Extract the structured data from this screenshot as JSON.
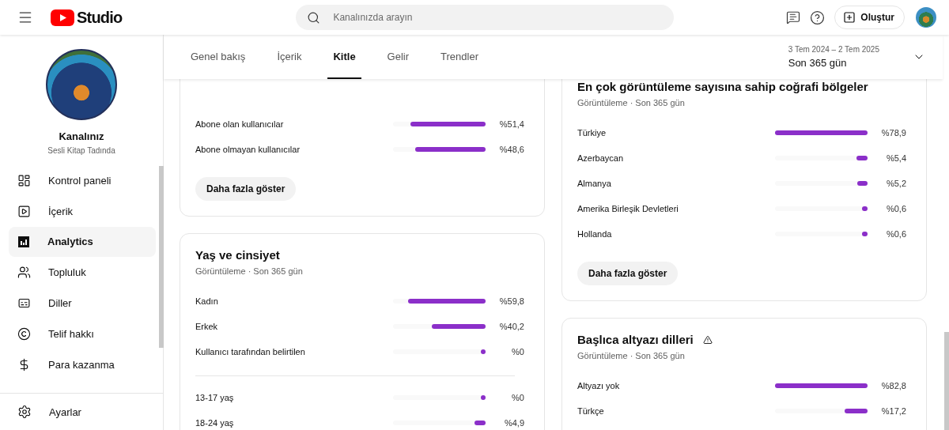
{
  "header": {
    "logo_text": "Studio",
    "search": {
      "placeholder": "Kanalınızda arayın"
    },
    "create_button": "Oluştur"
  },
  "sidebar": {
    "channel_title": "Kanalınız",
    "channel_name": "Sesli Kitap Tadında",
    "items": [
      {
        "label": "Kontrol paneli",
        "kind": "dashboard",
        "selected": false
      },
      {
        "label": "İçerik",
        "kind": "content",
        "selected": false
      },
      {
        "label": "Analytics",
        "kind": "analytics",
        "selected": true
      },
      {
        "label": "Topluluk",
        "kind": "community",
        "selected": false
      },
      {
        "label": "Diller",
        "kind": "subtitles",
        "selected": false
      },
      {
        "label": "Telif hakkı",
        "kind": "copyright",
        "selected": false
      },
      {
        "label": "Para kazanma",
        "kind": "money",
        "selected": false
      }
    ],
    "settings": "Ayarlar"
  },
  "tabs": [
    {
      "label": "Genel bakış",
      "selected": false
    },
    {
      "label": "İçerik",
      "selected": false
    },
    {
      "label": "Kitle",
      "selected": true
    },
    {
      "label": "Gelir",
      "selected": false
    },
    {
      "label": "Trendler",
      "selected": false
    }
  ],
  "date_range": {
    "dates": "3 Tem 2024 – 2 Tem 2025",
    "period": "Son 365 gün"
  },
  "columns": [
    [
      {
        "sections": [
          [
            {
              "label": "Abone olan kullanıcılar",
              "level": 0.8,
              "value": "%51,4"
            },
            {
              "label": "Abone olmayan kullanıcılar",
              "level": 0.75,
              "value": "%48,6"
            }
          ]
        ],
        "button": "Daha fazla göster"
      },
      {
        "title": "Yaş ve cinsiyet",
        "subtitle": "Görüntüleme · Son 365 gün",
        "sections": [
          [
            {
              "label": "Kadın",
              "level": 0.83,
              "value": "%59,8"
            },
            {
              "label": "Erkek",
              "level": 0.56,
              "value": "%40,2"
            },
            {
              "label": "Kullanıcı tarafından belirtilen",
              "level": 0,
              "value": "%0"
            }
          ],
          [
            {
              "label": "13-17 yaş",
              "level": 0,
              "value": "%0"
            },
            {
              "label": "18-24 yaş",
              "level": 0.07,
              "value": "%4,9"
            }
          ]
        ]
      }
    ],
    [
      {
        "title": "En çok görüntüleme sayısına sahip coğrafi bölgeler",
        "subtitle": "Görüntüleme · Son 365 gün",
        "sections": [
          [
            {
              "label": "Türkiye",
              "level": 1,
              "value": "%78,9"
            },
            {
              "label": "Azerbaycan",
              "level": 0.07,
              "value": "%5,4"
            },
            {
              "label": "Almanya",
              "level": 0.066,
              "value": "%5,2"
            },
            {
              "label": "Amerika Birleşik Devletleri",
              "level": 0.008,
              "value": "%0,6"
            },
            {
              "label": "Hollanda",
              "level": 0.008,
              "value": "%0,6"
            }
          ]
        ],
        "button": "Daha fazla göster"
      },
      {
        "title": "Başlıca altyazı dilleri",
        "warning": true,
        "subtitle": "Görüntüleme · Son 365 gün",
        "sections": [
          [
            {
              "label": "Altyazı yok",
              "level": 1,
              "value": "%82,8"
            },
            {
              "label": "Türkçe",
              "level": 0.21,
              "value": "%17,2"
            }
          ]
        ]
      }
    ]
  ]
}
